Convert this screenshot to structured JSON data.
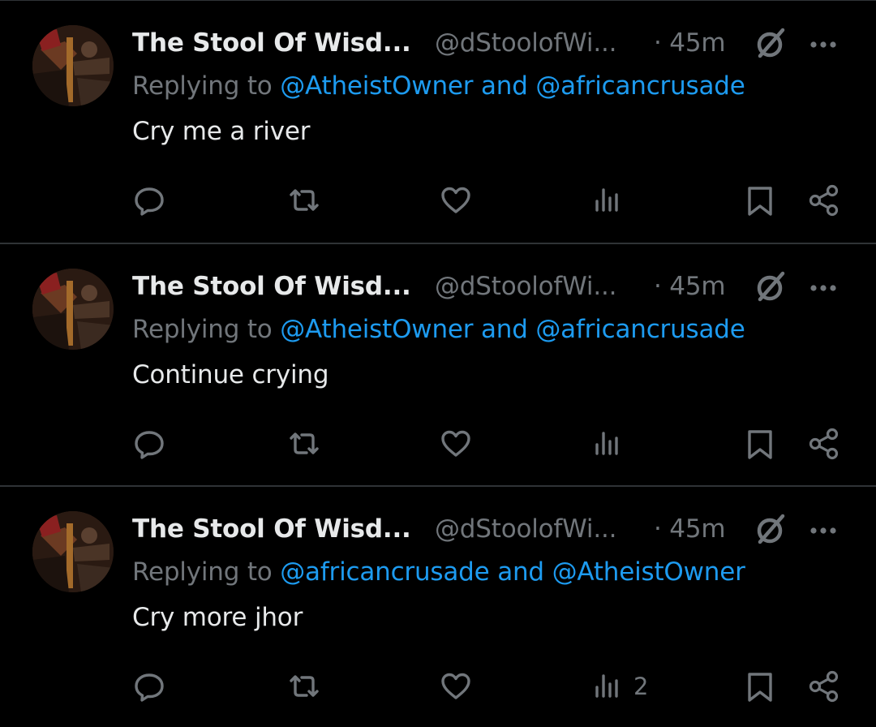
{
  "colors": {
    "background": "#000000",
    "text_primary": "#e7e9ea",
    "text_secondary": "#71767b",
    "mention": "#1d9bf0",
    "divider": "#2f3336"
  },
  "tweets": [
    {
      "author_name": "The Stool Of Wisd...",
      "handle": "@dStoolofWi...",
      "time": "· 45m",
      "reply_prefix": "Replying to",
      "mention_1": "@AtheistOwner",
      "conjunction": "and",
      "mention_2": "@africancrusade",
      "text": "Cry me a river",
      "views_count": ""
    },
    {
      "author_name": "The Stool Of Wisd...",
      "handle": "@dStoolofWi...",
      "time": "· 45m",
      "reply_prefix": "Replying to",
      "mention_1": "@AtheistOwner",
      "conjunction": "and",
      "mention_2": "@africancrusade",
      "text": "Continue crying",
      "views_count": ""
    },
    {
      "author_name": "The Stool Of Wisd...",
      "handle": "@dStoolofWi...",
      "time": "· 45m",
      "reply_prefix": "Replying to",
      "mention_1": "@africancrusade",
      "conjunction": "and",
      "mention_2": "@AtheistOwner",
      "text": "Cry more jhor",
      "views_count": "2"
    }
  ],
  "icons": {
    "avatar": "avatar-image",
    "grok": "grok-icon",
    "more": "more-icon",
    "reply": "reply-icon",
    "repost": "repost-icon",
    "like": "like-icon",
    "views": "views-icon",
    "bookmark": "bookmark-icon",
    "share": "share-icon"
  }
}
